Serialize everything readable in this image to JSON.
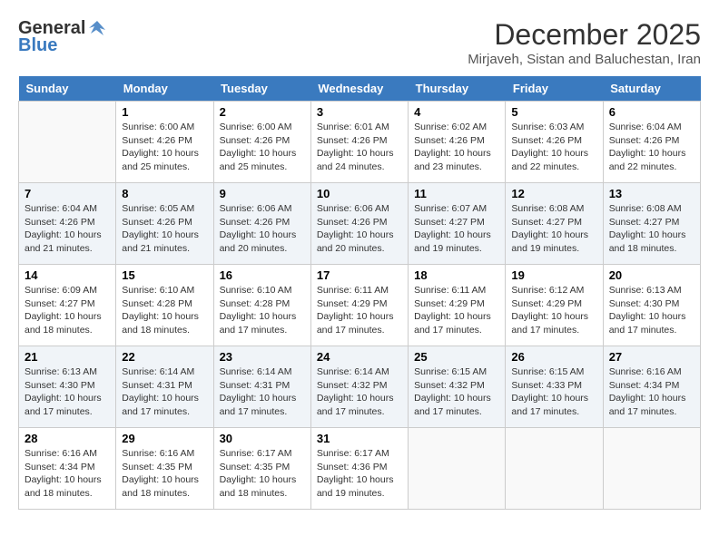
{
  "header": {
    "logo_general": "General",
    "logo_blue": "Blue",
    "month": "December 2025",
    "location": "Mirjaveh, Sistan and Baluchestan, Iran"
  },
  "days_of_week": [
    "Sunday",
    "Monday",
    "Tuesday",
    "Wednesday",
    "Thursday",
    "Friday",
    "Saturday"
  ],
  "weeks": [
    [
      {
        "day": "",
        "info": ""
      },
      {
        "day": "1",
        "info": "Sunrise: 6:00 AM\nSunset: 4:26 PM\nDaylight: 10 hours\nand 25 minutes."
      },
      {
        "day": "2",
        "info": "Sunrise: 6:00 AM\nSunset: 4:26 PM\nDaylight: 10 hours\nand 25 minutes."
      },
      {
        "day": "3",
        "info": "Sunrise: 6:01 AM\nSunset: 4:26 PM\nDaylight: 10 hours\nand 24 minutes."
      },
      {
        "day": "4",
        "info": "Sunrise: 6:02 AM\nSunset: 4:26 PM\nDaylight: 10 hours\nand 23 minutes."
      },
      {
        "day": "5",
        "info": "Sunrise: 6:03 AM\nSunset: 4:26 PM\nDaylight: 10 hours\nand 22 minutes."
      },
      {
        "day": "6",
        "info": "Sunrise: 6:04 AM\nSunset: 4:26 PM\nDaylight: 10 hours\nand 22 minutes."
      }
    ],
    [
      {
        "day": "7",
        "info": "Sunrise: 6:04 AM\nSunset: 4:26 PM\nDaylight: 10 hours\nand 21 minutes."
      },
      {
        "day": "8",
        "info": "Sunrise: 6:05 AM\nSunset: 4:26 PM\nDaylight: 10 hours\nand 21 minutes."
      },
      {
        "day": "9",
        "info": "Sunrise: 6:06 AM\nSunset: 4:26 PM\nDaylight: 10 hours\nand 20 minutes."
      },
      {
        "day": "10",
        "info": "Sunrise: 6:06 AM\nSunset: 4:26 PM\nDaylight: 10 hours\nand 20 minutes."
      },
      {
        "day": "11",
        "info": "Sunrise: 6:07 AM\nSunset: 4:27 PM\nDaylight: 10 hours\nand 19 minutes."
      },
      {
        "day": "12",
        "info": "Sunrise: 6:08 AM\nSunset: 4:27 PM\nDaylight: 10 hours\nand 19 minutes."
      },
      {
        "day": "13",
        "info": "Sunrise: 6:08 AM\nSunset: 4:27 PM\nDaylight: 10 hours\nand 18 minutes."
      }
    ],
    [
      {
        "day": "14",
        "info": "Sunrise: 6:09 AM\nSunset: 4:27 PM\nDaylight: 10 hours\nand 18 minutes."
      },
      {
        "day": "15",
        "info": "Sunrise: 6:10 AM\nSunset: 4:28 PM\nDaylight: 10 hours\nand 18 minutes."
      },
      {
        "day": "16",
        "info": "Sunrise: 6:10 AM\nSunset: 4:28 PM\nDaylight: 10 hours\nand 17 minutes."
      },
      {
        "day": "17",
        "info": "Sunrise: 6:11 AM\nSunset: 4:29 PM\nDaylight: 10 hours\nand 17 minutes."
      },
      {
        "day": "18",
        "info": "Sunrise: 6:11 AM\nSunset: 4:29 PM\nDaylight: 10 hours\nand 17 minutes."
      },
      {
        "day": "19",
        "info": "Sunrise: 6:12 AM\nSunset: 4:29 PM\nDaylight: 10 hours\nand 17 minutes."
      },
      {
        "day": "20",
        "info": "Sunrise: 6:13 AM\nSunset: 4:30 PM\nDaylight: 10 hours\nand 17 minutes."
      }
    ],
    [
      {
        "day": "21",
        "info": "Sunrise: 6:13 AM\nSunset: 4:30 PM\nDaylight: 10 hours\nand 17 minutes."
      },
      {
        "day": "22",
        "info": "Sunrise: 6:14 AM\nSunset: 4:31 PM\nDaylight: 10 hours\nand 17 minutes."
      },
      {
        "day": "23",
        "info": "Sunrise: 6:14 AM\nSunset: 4:31 PM\nDaylight: 10 hours\nand 17 minutes."
      },
      {
        "day": "24",
        "info": "Sunrise: 6:14 AM\nSunset: 4:32 PM\nDaylight: 10 hours\nand 17 minutes."
      },
      {
        "day": "25",
        "info": "Sunrise: 6:15 AM\nSunset: 4:32 PM\nDaylight: 10 hours\nand 17 minutes."
      },
      {
        "day": "26",
        "info": "Sunrise: 6:15 AM\nSunset: 4:33 PM\nDaylight: 10 hours\nand 17 minutes."
      },
      {
        "day": "27",
        "info": "Sunrise: 6:16 AM\nSunset: 4:34 PM\nDaylight: 10 hours\nand 17 minutes."
      }
    ],
    [
      {
        "day": "28",
        "info": "Sunrise: 6:16 AM\nSunset: 4:34 PM\nDaylight: 10 hours\nand 18 minutes."
      },
      {
        "day": "29",
        "info": "Sunrise: 6:16 AM\nSunset: 4:35 PM\nDaylight: 10 hours\nand 18 minutes."
      },
      {
        "day": "30",
        "info": "Sunrise: 6:17 AM\nSunset: 4:35 PM\nDaylight: 10 hours\nand 18 minutes."
      },
      {
        "day": "31",
        "info": "Sunrise: 6:17 AM\nSunset: 4:36 PM\nDaylight: 10 hours\nand 19 minutes."
      },
      {
        "day": "",
        "info": ""
      },
      {
        "day": "",
        "info": ""
      },
      {
        "day": "",
        "info": ""
      }
    ]
  ]
}
